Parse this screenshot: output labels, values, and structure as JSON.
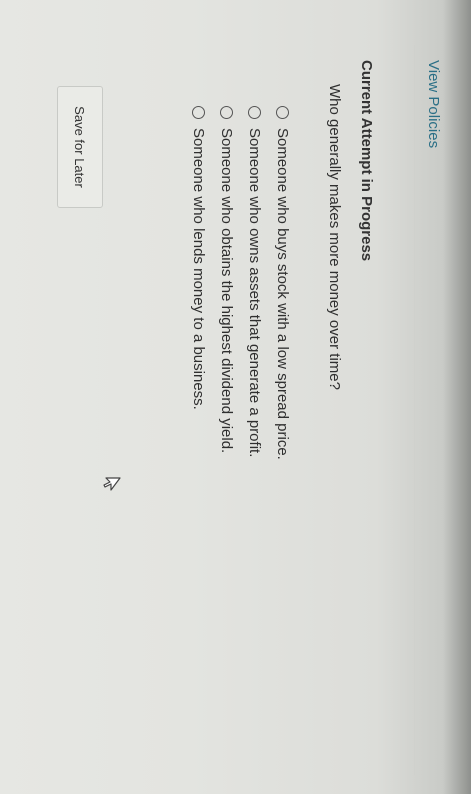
{
  "links": {
    "view_policies": "View Policies"
  },
  "attempt": {
    "title": "Current Attempt in Progress"
  },
  "question": {
    "text": "Who generally makes more money over time?",
    "options": [
      "Someone who buys stock with a low spread price.",
      "Someone who owns assets that generate a profit.",
      "Someone who obtains the highest dividend yield.",
      "Someone who lends money to a business."
    ]
  },
  "actions": {
    "save_label": "Save for Later"
  }
}
